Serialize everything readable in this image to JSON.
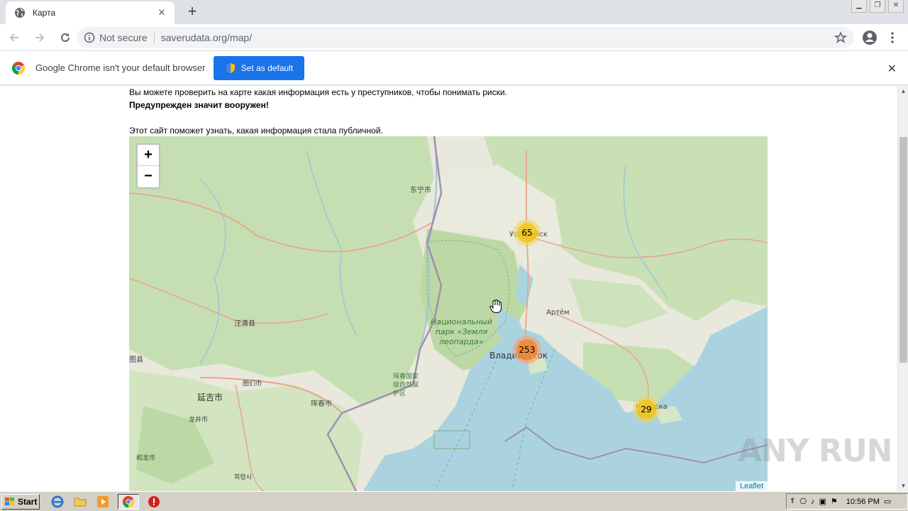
{
  "browser": {
    "tab": {
      "title": "Карта"
    },
    "address": {
      "security": "Not secure",
      "url": "saverudata.org/map/"
    },
    "infobar": {
      "message": "Google Chrome isn't your default browser",
      "button": "Set as default"
    }
  },
  "page": {
    "line1": "Вы можете проверить на карте какая информация есть у преступников, чтобы понимать риски.",
    "line2": "Предупрежден значит вооружен!",
    "line3": "Этот сайт поможет узнать, какая информация стала публичной."
  },
  "map": {
    "zoom_in": "+",
    "zoom_out": "−",
    "attribution": "Leaflet",
    "clusters": [
      {
        "count": "65",
        "color": "#f1d357"
      },
      {
        "count": "253",
        "color": "#fd9c73"
      },
      {
        "count": "29",
        "color": "#f1d357"
      }
    ],
    "labels": {
      "dongning": "东宁市",
      "ussuriysk": "Уссурийск",
      "artem": "Артём",
      "park": "Национальный\nпарк «Земля\nлеопарда»",
      "vladivostok": "Владивосток",
      "nakhodka": "Находка",
      "wangqing": "汪清县",
      "tumen_county": "图县",
      "yanji": "延吉市",
      "tumen": "图们市",
      "hunchun": "珲春市",
      "hunchun_reserve": "珲春国家\n级自然保\n护区",
      "longjing": "龙井市",
      "helong": "和龙市",
      "hoeryong": "회령시"
    }
  },
  "taskbar": {
    "start": "Start",
    "clock": "10:56 PM"
  },
  "watermark": "ANY RUN"
}
